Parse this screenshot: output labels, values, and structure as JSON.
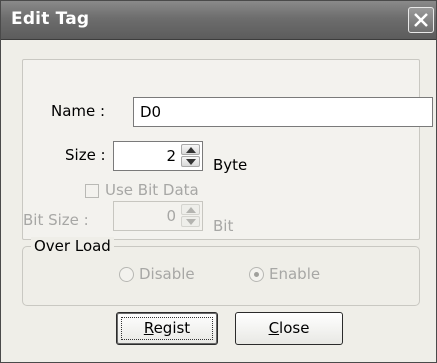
{
  "dialog": {
    "title": "Edit Tag"
  },
  "fields": {
    "name_label": "Name :",
    "name_value": "D0",
    "size_label": "Size :",
    "size_value": "2",
    "size_unit": "Byte",
    "use_bit_label": "Use Bit Data",
    "bit_size_label": "Bit Size :",
    "bit_size_value": "0",
    "bit_unit": "Bit"
  },
  "overload": {
    "title": "Over Load",
    "options": [
      "Disable",
      "Enable"
    ],
    "selected": "Enable"
  },
  "buttons": {
    "regist_first": "R",
    "regist_rest": "egist",
    "close_first": "C",
    "close_rest": "lose"
  },
  "icons": {
    "close": "close-icon",
    "spin_up": "arrow-up-icon",
    "spin_down": "arrow-down-icon"
  },
  "colors": {
    "titlebar": "#6d6d6d",
    "disabled_text": "#a7a7a5",
    "background": "#efeee8"
  }
}
